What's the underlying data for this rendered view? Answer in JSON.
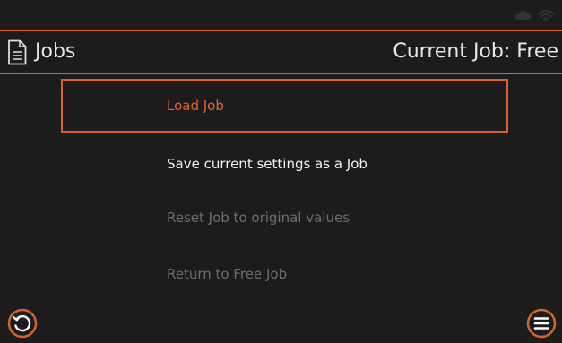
{
  "header": {
    "title": "Jobs",
    "current_job": "Current Job: Free"
  },
  "menu": {
    "items": [
      {
        "label": "Load Job",
        "state": "selected"
      },
      {
        "label": "Save current settings as a Job",
        "state": "enabled"
      },
      {
        "label": "Reset Job to original values",
        "state": "disabled"
      },
      {
        "label": "Return to Free Job",
        "state": "disabled"
      }
    ]
  },
  "status_icons": [
    "cloud-icon",
    "wifi-icon"
  ],
  "footer": {
    "left_icon": "back-icon",
    "right_icon": "menu-icon"
  },
  "colors": {
    "accent": "#d9622b",
    "background": "#1c1c1c",
    "text": "#f2f2f2",
    "disabled_text": "#6d6d6d"
  }
}
